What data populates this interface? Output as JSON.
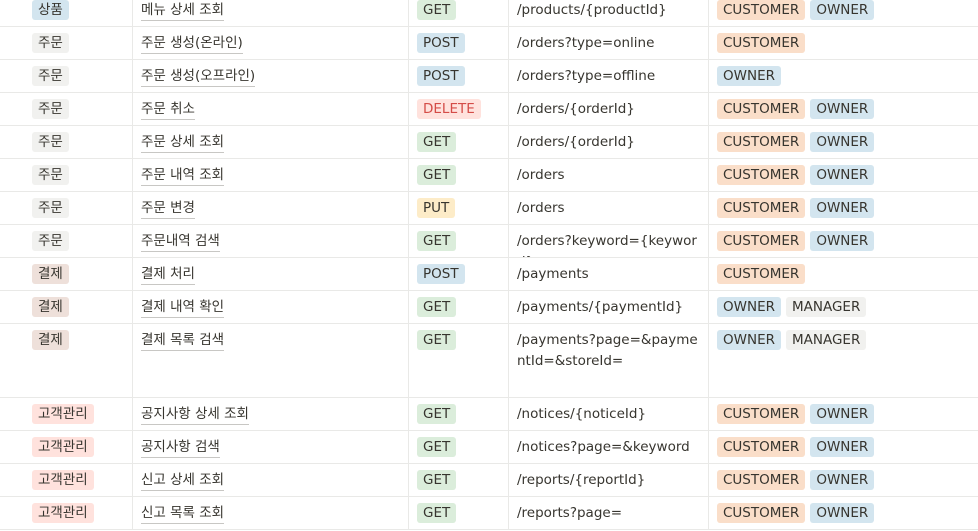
{
  "colors": {
    "category": {
      "상품": {
        "bg": "#d3e5ef",
        "fg": "#37352f"
      },
      "주문": {
        "bg": "#f1f1ef",
        "fg": "#37352f"
      },
      "결제": {
        "bg": "#eee0da",
        "fg": "#37352f"
      },
      "고객관리": {
        "bg": "#ffe2dd",
        "fg": "#37352f"
      }
    },
    "method": {
      "GET": {
        "bg": "#dbeddb",
        "fg": "#37352f"
      },
      "POST": {
        "bg": "#d3e5ef",
        "fg": "#37352f"
      },
      "DELETE": {
        "bg": "#ffe2dd",
        "fg": "#d44c47"
      },
      "PUT": {
        "bg": "#fdecc8",
        "fg": "#37352f"
      }
    },
    "role": {
      "CUSTOMER": {
        "bg": "#fadec9",
        "fg": "#37352f"
      },
      "OWNER": {
        "bg": "#d3e5ef",
        "fg": "#37352f"
      },
      "MANAGER": {
        "bg": "#f1f1ef",
        "fg": "#37352f"
      }
    }
  },
  "rows": [
    {
      "category": "상품",
      "name": "메뉴 상세 조회",
      "method": "GET",
      "path": "/products/{productId}",
      "roles": [
        "CUSTOMER",
        "OWNER"
      ]
    },
    {
      "category": "주문",
      "name": "주문 생성(온라인)",
      "method": "POST",
      "path": "/orders?type=online",
      "roles": [
        "CUSTOMER"
      ]
    },
    {
      "category": "주문",
      "name": "주문 생성(오프라인)",
      "method": "POST",
      "path": "/orders?type=offline",
      "roles": [
        "OWNER"
      ]
    },
    {
      "category": "주문",
      "name": "주문 취소",
      "method": "DELETE",
      "path": "/orders/{orderId}",
      "roles": [
        "CUSTOMER",
        "OWNER"
      ]
    },
    {
      "category": "주문",
      "name": "주문 상세 조회",
      "method": "GET",
      "path": "/orders/{orderId}",
      "roles": [
        "CUSTOMER",
        "OWNER"
      ]
    },
    {
      "category": "주문",
      "name": "주문 내역 조회",
      "method": "GET",
      "path": "/orders",
      "roles": [
        "CUSTOMER",
        "OWNER"
      ]
    },
    {
      "category": "주문",
      "name": "주문 변경",
      "method": "PUT",
      "path": "/orders",
      "roles": [
        "CUSTOMER",
        "OWNER"
      ]
    },
    {
      "category": "주문",
      "name": "주문내역 검색",
      "method": "GET",
      "path": "/orders?keyword={keyword}",
      "roles": [
        "CUSTOMER",
        "OWNER"
      ]
    },
    {
      "category": "결제",
      "name": "결제 처리",
      "method": "POST",
      "path": "/payments",
      "roles": [
        "CUSTOMER"
      ]
    },
    {
      "category": "결제",
      "name": "결제 내역 확인",
      "method": "GET",
      "path": "/payments/{paymentId}",
      "roles": [
        "OWNER",
        "MANAGER"
      ]
    },
    {
      "category": "결제",
      "name": "결제 목록 검색",
      "method": "GET",
      "path": "/payments?page=&paymentId=&storeId=",
      "roles": [
        "OWNER",
        "MANAGER"
      ]
    },
    {
      "category": "고객관리",
      "name": "공지사항 상세 조회",
      "method": "GET",
      "path": "/notices/{noticeId}",
      "roles": [
        "CUSTOMER",
        "OWNER"
      ]
    },
    {
      "category": "고객관리",
      "name": "공지사항 검색",
      "method": "GET",
      "path": "/notices?page=&keyword=",
      "roles": [
        "CUSTOMER",
        "OWNER"
      ]
    },
    {
      "category": "고객관리",
      "name": "신고 상세 조회",
      "method": "GET",
      "path": "/reports/{reportId}",
      "roles": [
        "CUSTOMER",
        "OWNER"
      ]
    },
    {
      "category": "고객관리",
      "name": "신고 목록 조회",
      "method": "GET",
      "path": "/reports?page=",
      "roles": [
        "CUSTOMER",
        "OWNER"
      ]
    }
  ]
}
